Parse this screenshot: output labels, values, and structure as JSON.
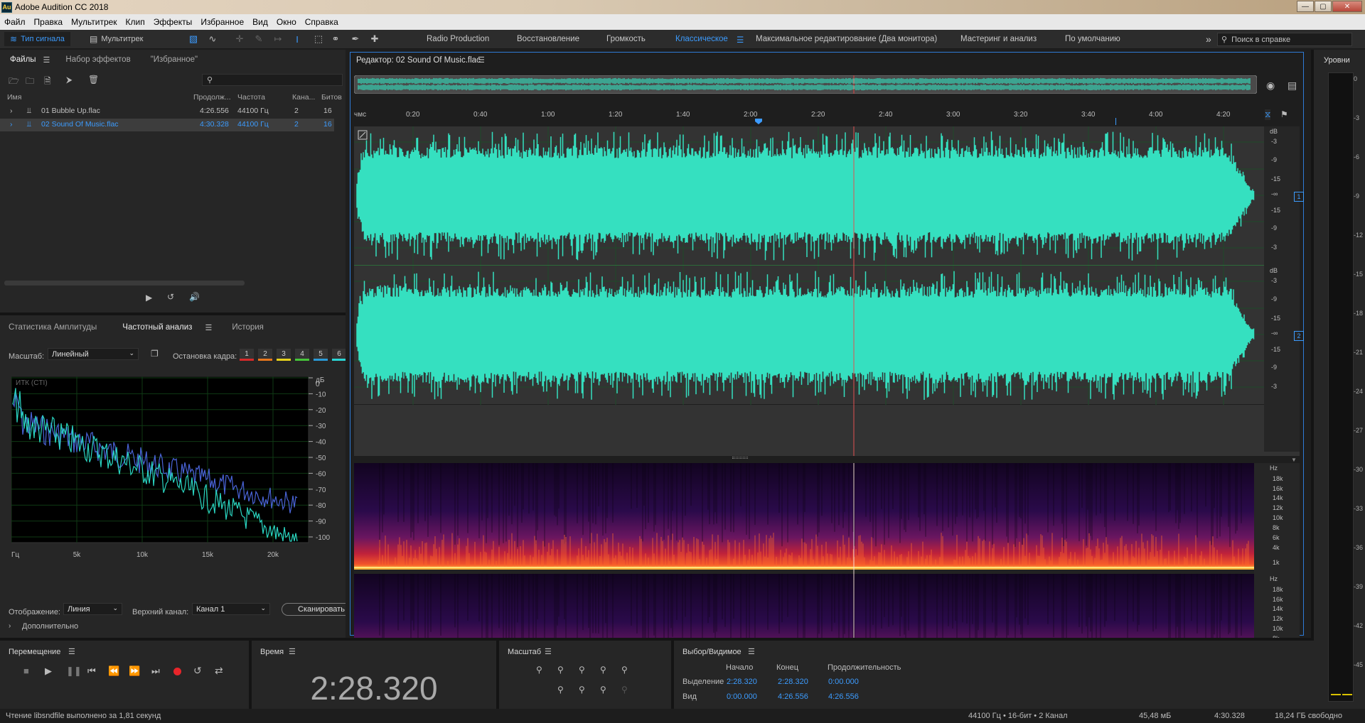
{
  "window": {
    "title": "Adobe Audition CC 2018",
    "icon_text": "Au"
  },
  "menu": [
    "Файл",
    "Правка",
    "Мультитрек",
    "Клип",
    "Эффекты",
    "Избранное",
    "Вид",
    "Окно",
    "Справка"
  ],
  "toolbar": {
    "mode_waveform": "Тип сигнала",
    "mode_multitrack": "Мультитрек",
    "workspaces": [
      "Radio Production",
      "Восстановление",
      "Громкость",
      "Классическое",
      "Максимальное редактирование (Два монитора)",
      "Мастеринг и анализ",
      "По умолчанию"
    ],
    "active_workspace": "Классическое",
    "help_placeholder": "Поиск в справке"
  },
  "files_panel": {
    "tabs": [
      "Файлы",
      "Набор эффектов",
      "\"Избранное\""
    ],
    "columns": [
      "Имя",
      "Продолж...",
      "Частота",
      "Кана...",
      "Битов"
    ],
    "rows": [
      {
        "name": "01 Bubble Up.flac",
        "duration": "4:26.556",
        "rate": "44100 Гц",
        "channels": "2",
        "bits": "16",
        "selected": false
      },
      {
        "name": "02 Sound Of Music.flac",
        "duration": "4:30.328",
        "rate": "44100 Гц",
        "channels": "2",
        "bits": "16",
        "selected": true
      }
    ]
  },
  "analysis_panel": {
    "tabs": [
      "Статистика Амплитуды",
      "Частотный анализ",
      "История"
    ],
    "scale_label": "Масштаб:",
    "scale_value": "Линейный",
    "freeze_label": "Остановка кадра:",
    "freeze_buttons": [
      "1",
      "2",
      "3",
      "4",
      "5",
      "6"
    ],
    "freeze_colors": [
      "#d62a2a",
      "#e8761c",
      "#e6d21c",
      "#46c43a",
      "#2a9ad6",
      "#2ad6d6"
    ],
    "graph_tag": "ИТК (CTI)",
    "db_unit": "дБ",
    "db_ticks": [
      "0",
      "-10",
      "-20",
      "-30",
      "-40",
      "-50",
      "-60",
      "-70",
      "-80",
      "-90",
      "-100"
    ],
    "freq_ticks": [
      "Гц",
      "5k",
      "10k",
      "15k",
      "20k"
    ],
    "display_label": "Отображение:",
    "display_value": "Линия",
    "channel_label": "Верхний канал:",
    "channel_value": "Канал 1",
    "scan_button": "Сканировать",
    "advanced": "Дополнительно",
    "line_colors": [
      "#4a64d8",
      "#2ad6c2"
    ]
  },
  "editor": {
    "title": "Редактор: 02 Sound Of Music.flac",
    "ruler_unit": "чмс",
    "ruler": [
      "0:20",
      "0:40",
      "1:00",
      "1:20",
      "1:40",
      "2:00",
      "2:20",
      "2:40",
      "3:00",
      "3:20",
      "3:40",
      "4:00",
      "4:20"
    ],
    "db_unit": "dB",
    "db_scale": [
      "-3",
      "-9",
      "-15",
      "-∞",
      "-15",
      "-9",
      "-3"
    ],
    "channel_numbers": [
      "1",
      "2"
    ],
    "hz_unit": "Hz",
    "hz_scale": [
      "18k",
      "16k",
      "14k",
      "12k",
      "10k",
      "8k",
      "6k",
      "4k",
      "1k"
    ],
    "waveform_color": "#35e0c0"
  },
  "levels_panel": {
    "title": "Уровни",
    "ticks": [
      "0",
      "-3",
      "-6",
      "-9",
      "-12",
      "-15",
      "-18",
      "-21",
      "-24",
      "-27",
      "-30",
      "-33",
      "-36",
      "-39",
      "-42",
      "-45"
    ]
  },
  "transport": {
    "title": "Перемещение"
  },
  "time_panel": {
    "title": "Время",
    "value": "2:28.320"
  },
  "zoom_panel": {
    "title": "Масштаб"
  },
  "selection_panel": {
    "title": "Выбор/Видимое",
    "headers": [
      "Начало",
      "Конец",
      "Продолжительность"
    ],
    "selection_label": "Выделение",
    "selection": [
      "2:28.320",
      "2:28.320",
      "0:00.000"
    ],
    "view_label": "Вид",
    "view": [
      "0:00.000",
      "4:26.556",
      "4:26.556"
    ]
  },
  "status": {
    "left": "Чтение libsndfile выполнено за 1,81 секунд",
    "format": "44100 Гц • 16-бит • 2 Канал",
    "size": "45,48 мБ",
    "duration": "4:30.328",
    "free": "18,24 ГБ свободно"
  }
}
